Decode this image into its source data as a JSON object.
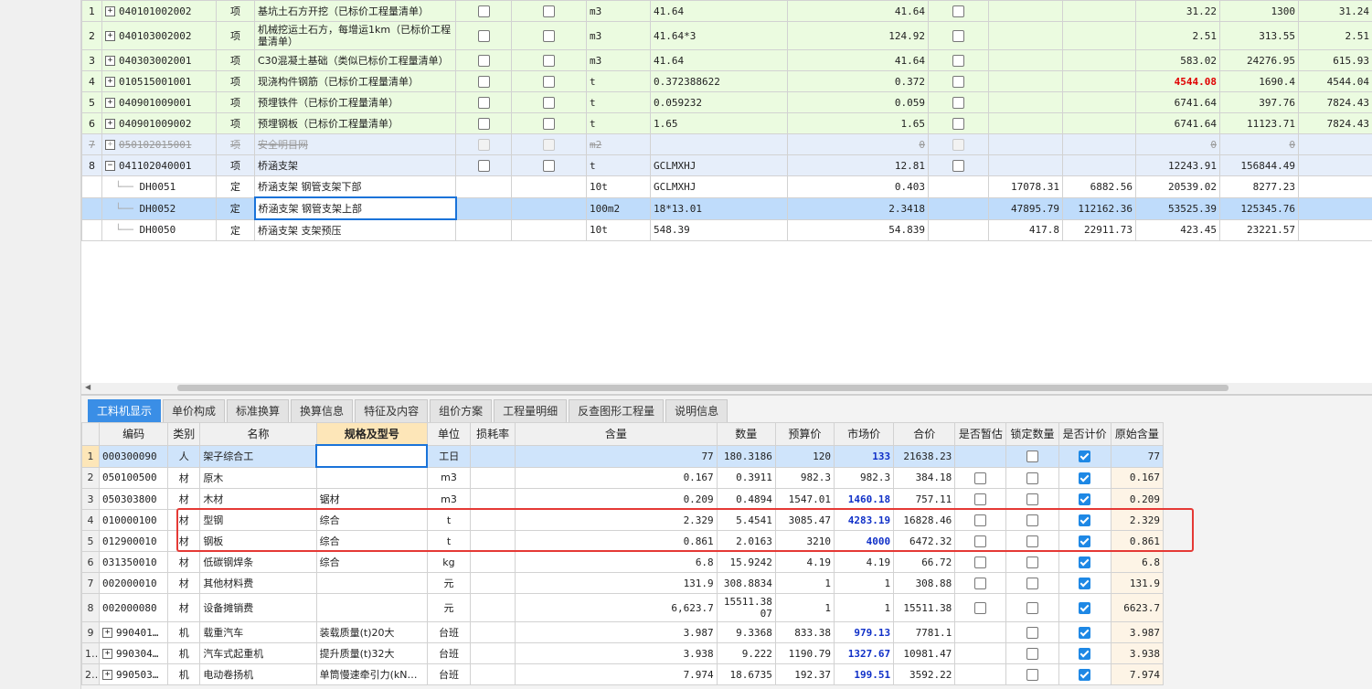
{
  "top_rows": [
    {
      "no": "1",
      "code": "040101002002",
      "unit": "项",
      "name": "基坑土石方开挖（已标价工程量清单）",
      "u2": "m3",
      "expr": "41.64",
      "qty": "41.64",
      "c1": "",
      "c2": "",
      "c3": "31.22",
      "c4": "1300",
      "c5": "31.24",
      "style": "g",
      "checks": true
    },
    {
      "no": "2",
      "code": "040103002002",
      "unit": "项",
      "name": "机械挖运土石方，每增运1km（已标价工程量清单）",
      "u2": "m3",
      "expr": "41.64*3",
      "qty": "124.92",
      "c1": "",
      "c2": "",
      "c3": "2.51",
      "c4": "313.55",
      "c5": "2.51",
      "style": "g",
      "checks": true
    },
    {
      "no": "3",
      "code": "040303002001",
      "unit": "项",
      "name": "C30混凝土基础（类似已标价工程量清单）",
      "u2": "m3",
      "expr": "41.64",
      "qty": "41.64",
      "c1": "",
      "c2": "",
      "c3": "583.02",
      "c4": "24276.95",
      "c5": "615.93",
      "style": "g",
      "checks": true
    },
    {
      "no": "4",
      "code": "010515001001",
      "unit": "项",
      "name": "现浇构件钢筋（已标价工程量清单）",
      "u2": "t",
      "expr": "0.372388622",
      "qty": "0.372",
      "c1": "",
      "c2": "",
      "c3": "4544.08",
      "c4": "1690.4",
      "c5": "4544.04",
      "style": "g",
      "checks": true,
      "red": true
    },
    {
      "no": "5",
      "code": "040901009001",
      "unit": "项",
      "name": "预埋铁件（已标价工程量清单）",
      "u2": "t",
      "expr": "0.059232",
      "qty": "0.059",
      "c1": "",
      "c2": "",
      "c3": "6741.64",
      "c4": "397.76",
      "c5": "7824.43",
      "style": "g",
      "checks": true
    },
    {
      "no": "6",
      "code": "040901009002",
      "unit": "项",
      "name": "预埋钢板（已标价工程量清单）",
      "u2": "t",
      "expr": "1.65",
      "qty": "1.65",
      "c1": "",
      "c2": "",
      "c3": "6741.64",
      "c4": "11123.71",
      "c5": "7824.43",
      "style": "g",
      "checks": true
    },
    {
      "no": "7",
      "code": "050102015001",
      "unit": "项",
      "name": "安全明目网",
      "u2": "m2",
      "expr": "",
      "qty": "0",
      "c1": "",
      "c2": "",
      "c3": "0",
      "c4": "0",
      "c5": "",
      "style": "del",
      "checks": true
    },
    {
      "no": "8",
      "code": "041102040001",
      "unit": "项",
      "name": "桥涵支架",
      "u2": "t",
      "expr": "GCLMXHJ",
      "qty": "12.81",
      "c1": "",
      "c2": "",
      "c3": "12243.91",
      "c4": "156844.49",
      "c5": "",
      "style": "b",
      "checks": true,
      "minus": true
    },
    {
      "no": "",
      "code": "DH0051",
      "unit": "定",
      "name": "桥涵支架 钢管支架下部",
      "u2": "10t",
      "expr": "GCLMXHJ",
      "qty": "0.403",
      "c1": "17078.31",
      "c2": "6882.56",
      "c3": "20539.02",
      "c4": "8277.23",
      "c5": "",
      "style": "w",
      "child": true
    },
    {
      "no": "",
      "code": "DH0052",
      "unit": "定",
      "name": "桥涵支架 钢管支架上部",
      "u2": "100m2",
      "expr": "18*13.01",
      "qty": "2.3418",
      "c1": "47895.79",
      "c2": "112162.36",
      "c3": "53525.39",
      "c4": "125345.76",
      "c5": "",
      "style": "sel",
      "child": true
    },
    {
      "no": "",
      "code": "DH0050",
      "unit": "定",
      "name": "桥涵支架 支架预压",
      "u2": "10t",
      "expr": "548.39",
      "qty": "54.839",
      "c1": "417.8",
      "c2": "22911.73",
      "c3": "423.45",
      "c4": "23221.57",
      "c5": "",
      "style": "w",
      "child": true
    }
  ],
  "tabs": [
    "工料机显示",
    "单价构成",
    "标准换算",
    "换算信息",
    "特征及内容",
    "组价方案",
    "工程量明细",
    "反查图形工程量",
    "说明信息"
  ],
  "bottom_headers": [
    "编码",
    "类别",
    "名称",
    "规格及型号",
    "单位",
    "损耗率",
    "含量",
    "数量",
    "预算价",
    "市场价",
    "合价",
    "是否暂估",
    "锁定数量",
    "是否计价",
    "原始含量"
  ],
  "bottom_rows": [
    {
      "rn": "1",
      "code": "000300090",
      "type": "人",
      "name": "架子综合工",
      "spec": "",
      "unit": "工日",
      "loss": "",
      "content": "77",
      "qty": "180.3186",
      "budget": "120",
      "market": "133",
      "total": "21638.23",
      "est": null,
      "lock": false,
      "priced": true,
      "orig": "77",
      "blue": true,
      "sel": true
    },
    {
      "rn": "2",
      "code": "050100500",
      "type": "材",
      "name": "原木",
      "spec": "",
      "unit": "m3",
      "loss": "",
      "content": "0.167",
      "qty": "0.3911",
      "budget": "982.3",
      "market": "982.3",
      "total": "384.18",
      "est": false,
      "lock": false,
      "priced": true,
      "orig": "0.167"
    },
    {
      "rn": "3",
      "code": "050303800",
      "type": "材",
      "name": "木材",
      "spec": "锯材",
      "unit": "m3",
      "loss": "",
      "content": "0.209",
      "qty": "0.4894",
      "budget": "1547.01",
      "market": "1460.18",
      "total": "757.11",
      "est": false,
      "lock": false,
      "priced": true,
      "orig": "0.209",
      "blue": true
    },
    {
      "rn": "4",
      "code": "010000100",
      "type": "材",
      "name": "型钢",
      "spec": "综合",
      "unit": "t",
      "loss": "",
      "content": "2.329",
      "qty": "5.4541",
      "budget": "3085.47",
      "market": "4283.19",
      "total": "16828.46",
      "est": false,
      "lock": false,
      "priced": true,
      "orig": "2.329",
      "blue": true
    },
    {
      "rn": "5",
      "code": "012900010",
      "type": "材",
      "name": "钢板",
      "spec": "综合",
      "unit": "t",
      "loss": "",
      "content": "0.861",
      "qty": "2.0163",
      "budget": "3210",
      "market": "4000",
      "total": "6472.32",
      "est": false,
      "lock": false,
      "priced": true,
      "orig": "0.861",
      "blue": true
    },
    {
      "rn": "6",
      "code": "031350010",
      "type": "材",
      "name": "低碳钢焊条",
      "spec": "综合",
      "unit": "kg",
      "loss": "",
      "content": "6.8",
      "qty": "15.9242",
      "budget": "4.19",
      "market": "4.19",
      "total": "66.72",
      "est": false,
      "lock": false,
      "priced": true,
      "orig": "6.8"
    },
    {
      "rn": "7",
      "code": "002000010",
      "type": "材",
      "name": "其他材料费",
      "spec": "",
      "unit": "元",
      "loss": "",
      "content": "131.9",
      "qty": "308.8834",
      "budget": "1",
      "market": "1",
      "total": "308.88",
      "est": false,
      "lock": false,
      "priced": true,
      "orig": "131.9"
    },
    {
      "rn": "8",
      "code": "002000080",
      "type": "材",
      "name": "设备摊销费",
      "spec": "",
      "unit": "元",
      "loss": "",
      "content": "6,623.7",
      "qty": "15511.3807",
      "budget": "1",
      "market": "1",
      "total": "15511.38",
      "est": false,
      "lock": false,
      "priced": true,
      "orig": "6623.7",
      "tall": true
    },
    {
      "rn": "9",
      "code": "990401…",
      "type": "机",
      "name": "载重汽车",
      "spec": "装载质量(t)20大",
      "unit": "台班",
      "loss": "",
      "content": "3.987",
      "qty": "9.3368",
      "budget": "833.38",
      "market": "979.13",
      "total": "7781.1",
      "est": null,
      "lock": false,
      "priced": true,
      "orig": "3.987",
      "blue": true,
      "exp": true
    },
    {
      "rn": "16",
      "code": "990304…",
      "type": "机",
      "name": "汽车式起重机",
      "spec": "提升质量(t)32大",
      "unit": "台班",
      "loss": "",
      "content": "3.938",
      "qty": "9.222",
      "budget": "1190.79",
      "market": "1327.67",
      "total": "10981.47",
      "est": null,
      "lock": false,
      "priced": true,
      "orig": "3.938",
      "blue": true,
      "exp": true
    },
    {
      "rn": "23",
      "code": "990503…",
      "type": "机",
      "name": "电动卷扬机",
      "spec": "单筒慢速牵引力(kN…",
      "unit": "台班",
      "loss": "",
      "content": "7.974",
      "qty": "18.6735",
      "budget": "192.37",
      "market": "199.51",
      "total": "3592.22",
      "est": null,
      "lock": false,
      "priced": true,
      "orig": "7.974",
      "blue": true,
      "exp": true
    }
  ]
}
